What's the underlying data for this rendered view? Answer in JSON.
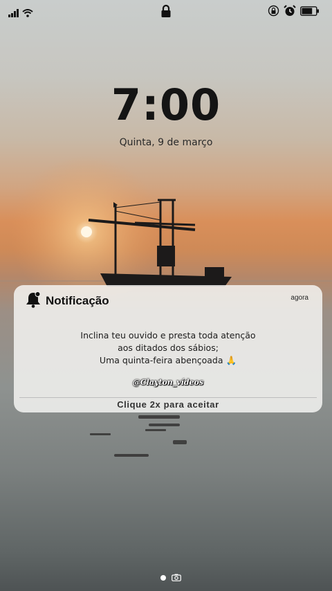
{
  "lockscreen": {
    "time": "7:00",
    "date": "Quinta, 9 de março"
  },
  "status_bar": {
    "icons": [
      "signal-icon",
      "wifi-icon",
      "lock-icon",
      "rotation-lock-icon",
      "alarm-icon",
      "battery-icon"
    ],
    "battery_level": 0.75
  },
  "notification": {
    "icon": "bell-icon",
    "title": "Notificação",
    "time": "agora",
    "body_lines": [
      "Inclina teu ouvido e presta toda atenção",
      "aos ditados dos sábios;",
      "Uma quinta-feira abençoada 🙏"
    ],
    "handle": "@Clayton_vídeos",
    "action_label": "Clique 2x para aceitar"
  },
  "page_indicators": [
    "dot",
    "camera-icon"
  ],
  "colors": {
    "sky_top": "#c9cdcc",
    "sunset": "#d98f5a",
    "sea": "#7b807f",
    "card_bg": "#f3f3f1"
  }
}
